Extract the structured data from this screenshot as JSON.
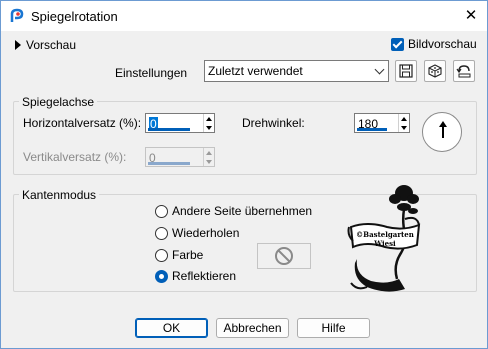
{
  "window": {
    "title": "Spiegelrotation",
    "close_icon": "close-icon",
    "app_icon": "paintshop-icon"
  },
  "preview": {
    "label": "Vorschau",
    "checkbox_label": "Bildvorschau",
    "checked": true
  },
  "settings": {
    "label": "Einstellungen",
    "selected": "Zuletzt verwendet",
    "icons": [
      "save-icon",
      "randomize-icon",
      "reset-icon"
    ]
  },
  "mirror_axis": {
    "title": "Spiegelachse",
    "horizontal_label": "Horizontalversatz (%):",
    "horizontal_value": "0",
    "vertical_label": "Vertikalversatz (%):",
    "vertical_value": "0",
    "angle_label": "Drehwinkel:",
    "angle_value": "180"
  },
  "edge_mode": {
    "title": "Kantenmodus",
    "options": [
      "Andere Seite übernehmen",
      "Wiederholen",
      "Farbe",
      "Reflektieren"
    ],
    "selected": "Reflektieren"
  },
  "watermark": {
    "line1": "©Bastelgarten",
    "line2": "Wiesi"
  },
  "buttons": {
    "ok": "OK",
    "cancel": "Abbrechen",
    "help": "Hilfe"
  },
  "colors": {
    "accent": "#005fb8",
    "selection": "#0078d7",
    "dialog_bg": "#f0f0f0"
  }
}
